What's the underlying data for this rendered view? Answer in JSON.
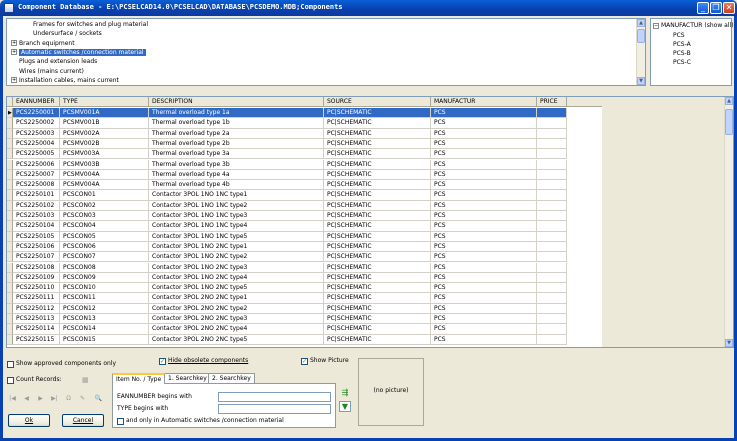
{
  "window": {
    "title": "Component Database - E:\\PCSELCAD14.0\\PCSELCAD\\DATABASE\\PCSDEMO.MDB;Components",
    "minimize_glyph": "_",
    "maximize_glyph": "❐",
    "close_glyph": "✕"
  },
  "tree": {
    "items": [
      {
        "label": "Frames for switches and plug material",
        "expander": "",
        "selected": false,
        "indent": 1
      },
      {
        "label": "Undersurface / sockets",
        "expander": "",
        "selected": false,
        "indent": 1
      },
      {
        "label": "Branch equipment",
        "expander": "+",
        "selected": false,
        "indent": 0
      },
      {
        "label": "Automatic switches /connection material",
        "expander": "+",
        "selected": true,
        "indent": 0
      },
      {
        "label": "Plugs and extension leads",
        "expander": "",
        "selected": false,
        "indent": 0
      },
      {
        "label": "Wires (mains current)",
        "expander": "",
        "selected": false,
        "indent": 0
      },
      {
        "label": "Installation cables, mains current",
        "expander": "+",
        "selected": false,
        "indent": 0
      }
    ]
  },
  "manufacturer_tree": {
    "root": "MANUFACTUR (show all)",
    "root_expander": "−",
    "items": [
      "PCS",
      "PCS-A",
      "PCS-B",
      "PCS-C"
    ]
  },
  "grid": {
    "columns": [
      "EANNUMBER",
      "TYPE",
      "DESCRIPTION",
      "SOURCE",
      "MANUFACTUR",
      "PRICE"
    ],
    "rows": [
      [
        "PCS2250001",
        "PCSMV001A",
        "Thermal overload type 1a",
        "PC|SCHEMATIC",
        "PCS",
        ""
      ],
      [
        "PCS2250002",
        "PCSMV001B",
        "Thermal overload type 1b",
        "PC|SCHEMATIC",
        "PCS",
        ""
      ],
      [
        "PCS2250003",
        "PCSMV002A",
        "Thermal overload type 2a",
        "PC|SCHEMATIC",
        "PCS",
        ""
      ],
      [
        "PCS2250004",
        "PCSMV002B",
        "Thermal overload type 2b",
        "PC|SCHEMATIC",
        "PCS",
        ""
      ],
      [
        "PCS2250005",
        "PCSMV003A",
        "Thermal overload type 3a",
        "PC|SCHEMATIC",
        "PCS",
        ""
      ],
      [
        "PCS2250006",
        "PCSMV003B",
        "Thermal overload type 3b",
        "PC|SCHEMATIC",
        "PCS",
        ""
      ],
      [
        "PCS2250007",
        "PCSMV004A",
        "Thermal overload type 4a",
        "PC|SCHEMATIC",
        "PCS",
        ""
      ],
      [
        "PCS2250008",
        "PCSMV004A",
        "Thermal overload type 4b",
        "PC|SCHEMATIC",
        "PCS",
        ""
      ],
      [
        "PCS2250101",
        "PCSCON01",
        "Contactor 3POL 1NO 1NC type1",
        "PC|SCHEMATIC",
        "PCS",
        ""
      ],
      [
        "PCS2250102",
        "PCSCON02",
        "Contactor 3POL 1NO 1NC type2",
        "PC|SCHEMATIC",
        "PCS",
        ""
      ],
      [
        "PCS2250103",
        "PCSCON03",
        "Contactor 3POL 1NO 1NC type3",
        "PC|SCHEMATIC",
        "PCS",
        ""
      ],
      [
        "PCS2250104",
        "PCSCON04",
        "Contactor 3POL 1NO 1NC type4",
        "PC|SCHEMATIC",
        "PCS",
        ""
      ],
      [
        "PCS2250105",
        "PCSCON05",
        "Contactor 3POL 1NO 1NC type5",
        "PC|SCHEMATIC",
        "PCS",
        ""
      ],
      [
        "PCS2250106",
        "PCSCON06",
        "Contactor 3POL 1NO 2NC type1",
        "PC|SCHEMATIC",
        "PCS",
        ""
      ],
      [
        "PCS2250107",
        "PCSCON07",
        "Contactor 3POL 1NO 2NC type2",
        "PC|SCHEMATIC",
        "PCS",
        ""
      ],
      [
        "PCS2250108",
        "PCSCON08",
        "Contactor 3POL 1NO 2NC type3",
        "PC|SCHEMATIC",
        "PCS",
        ""
      ],
      [
        "PCS2250109",
        "PCSCON09",
        "Contactor 3POL 1NO 2NC type4",
        "PC|SCHEMATIC",
        "PCS",
        ""
      ],
      [
        "PCS2250110",
        "PCSCON10",
        "Contactor 3POL 1NO 2NC type5",
        "PC|SCHEMATIC",
        "PCS",
        ""
      ],
      [
        "PCS2250111",
        "PCSCON11",
        "Contactor 3POL 2NO 2NC type1",
        "PC|SCHEMATIC",
        "PCS",
        ""
      ],
      [
        "PCS2250112",
        "PCSCON12",
        "Contactor 3POL 2NO 2NC type2",
        "PC|SCHEMATIC",
        "PCS",
        ""
      ],
      [
        "PCS2250113",
        "PCSCON13",
        "Contactor 3POL 2NO 2NC type3",
        "PC|SCHEMATIC",
        "PCS",
        ""
      ],
      [
        "PCS2250114",
        "PCSCON14",
        "Contactor 3POL 2NO 2NC type4",
        "PC|SCHEMATIC",
        "PCS",
        ""
      ],
      [
        "PCS2250115",
        "PCSCON15",
        "Contactor 3POL 2NO 2NC type5",
        "PC|SCHEMATIC",
        "PCS",
        ""
      ]
    ],
    "selected_row": 0,
    "row_indicator": "▶"
  },
  "options": {
    "show_approved": {
      "label": "Show approved components only",
      "checked": false
    },
    "hide_obsolete": {
      "label": "Hide obsolete components",
      "checked": true
    },
    "show_picture": {
      "label": "Show Picture",
      "checked": true
    },
    "count_records": {
      "label": "Count Records:",
      "checked": false
    },
    "check_glyph": "✓"
  },
  "navigator": {
    "buttons": [
      {
        "name": "nav-first-button",
        "glyph": "|◀"
      },
      {
        "name": "nav-prior-button",
        "glyph": "◀"
      },
      {
        "name": "nav-next-button",
        "glyph": "▶"
      },
      {
        "name": "nav-last-button",
        "glyph": "▶|"
      },
      {
        "name": "nav-refresh-button",
        "glyph": "Ω"
      },
      {
        "name": "nav-edit-button",
        "glyph": "✎"
      },
      {
        "name": "nav-find-button",
        "glyph": "🔍"
      }
    ]
  },
  "buttons": {
    "ok": "Ok",
    "cancel": "Cancel"
  },
  "search": {
    "tabs": [
      "Item No. / Type",
      "1. Searchkey",
      "2. Searchkey"
    ],
    "active_tab": 0,
    "ean_label": "EANNUMBER begins with",
    "type_label": "TYPE begins with",
    "ean_value": "",
    "type_value": "",
    "only_in_label": "and only in Automatic switches /connection material",
    "only_in_checked": false
  },
  "preview": {
    "text": "(no picture)"
  },
  "icons": {
    "clear_filter": "clear-filter-icon",
    "apply_filter": "filter-icon"
  }
}
